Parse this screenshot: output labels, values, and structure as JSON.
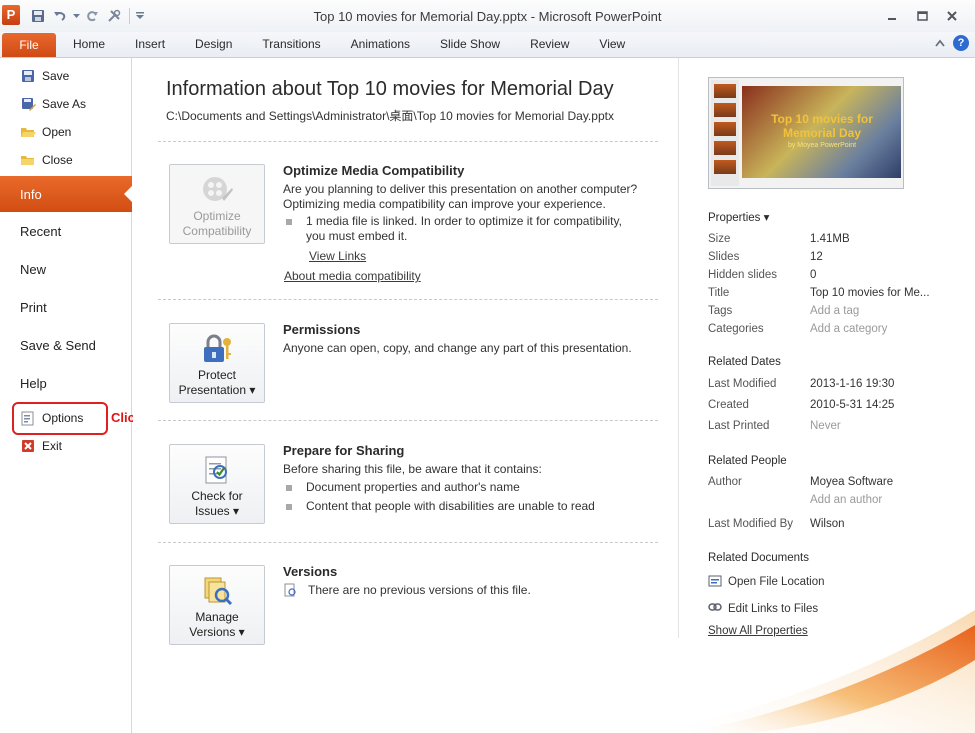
{
  "window": {
    "app_icon_letter": "P",
    "title": "Top 10 movies for Memorial Day.pptx  -  Microsoft PowerPoint"
  },
  "ribbon": {
    "file_tab": "File",
    "tabs": [
      "Home",
      "Insert",
      "Design",
      "Transitions",
      "Animations",
      "Slide Show",
      "Review",
      "View"
    ]
  },
  "nav": {
    "commands": [
      "Save",
      "Save As",
      "Open",
      "Close"
    ],
    "tabs": [
      "Info",
      "Recent",
      "New",
      "Print",
      "Save & Send",
      "Help"
    ],
    "bottom_commands": [
      "Options",
      "Exit"
    ],
    "callout": "Click here"
  },
  "info": {
    "title": "Information about Top 10 movies for Memorial Day",
    "path": "C:\\Documents and Settings\\Administrator\\桌面\\Top 10 movies for Memorial Day.pptx",
    "optimize": {
      "button_line1": "Optimize",
      "button_line2": "Compatibility",
      "title": "Optimize Media Compatibility",
      "text1": "Are you planning to deliver this presentation on another computer?",
      "text2": "Optimizing media compatibility can improve your experience.",
      "bullet1": "1 media file is linked. In order to optimize it for compatibility,",
      "bullet1b": "you must embed it.",
      "view_links": "View Links",
      "about_link": "About media compatibility"
    },
    "permissions": {
      "button_line1": "Protect",
      "button_line2": "Presentation ▾",
      "title": "Permissions",
      "text": "Anyone can open, copy, and change any part of this presentation."
    },
    "sharing": {
      "button_line1": "Check for",
      "button_line2": "Issues ▾",
      "title": "Prepare for Sharing",
      "text": "Before sharing this file, be aware that it contains:",
      "bullets": [
        "Document properties and author's name",
        "Content that people with disabilities are unable to read"
      ]
    },
    "versions": {
      "button_line1": "Manage",
      "button_line2": "Versions ▾",
      "title": "Versions",
      "text": "There are no previous versions of this file."
    }
  },
  "panel": {
    "thumbnail_title": "Top 10 movies for Memorial Day",
    "thumbnail_subtitle": "by Moyea PowerPoint",
    "properties_heading": "Properties ▾",
    "properties": [
      {
        "label": "Size",
        "value": "1.41MB"
      },
      {
        "label": "Slides",
        "value": "12"
      },
      {
        "label": "Hidden slides",
        "value": "0"
      },
      {
        "label": "Title",
        "value": "Top 10 movies for Me..."
      },
      {
        "label": "Tags",
        "value": "Add a tag"
      },
      {
        "label": "Categories",
        "value": "Add a category"
      }
    ],
    "dates_heading": "Related Dates",
    "dates": [
      {
        "label": "Last Modified",
        "value": "2013-1-16 19:30"
      },
      {
        "label": "Created",
        "value": "2010-5-31 14:25"
      },
      {
        "label": "Last Printed",
        "value": "Never"
      }
    ],
    "people_heading": "Related People",
    "author_label": "Author",
    "author_value": "Moyea Software",
    "add_author": "Add an author",
    "last_modified_by_label": "Last Modified By",
    "last_modified_by_value": "Wilson",
    "documents_heading": "Related Documents",
    "open_file_location": "Open File Location",
    "edit_links": "Edit Links to Files",
    "show_all": "Show All Properties"
  },
  "colors": {
    "accent": "#d9531a",
    "callout": "#e01414"
  }
}
